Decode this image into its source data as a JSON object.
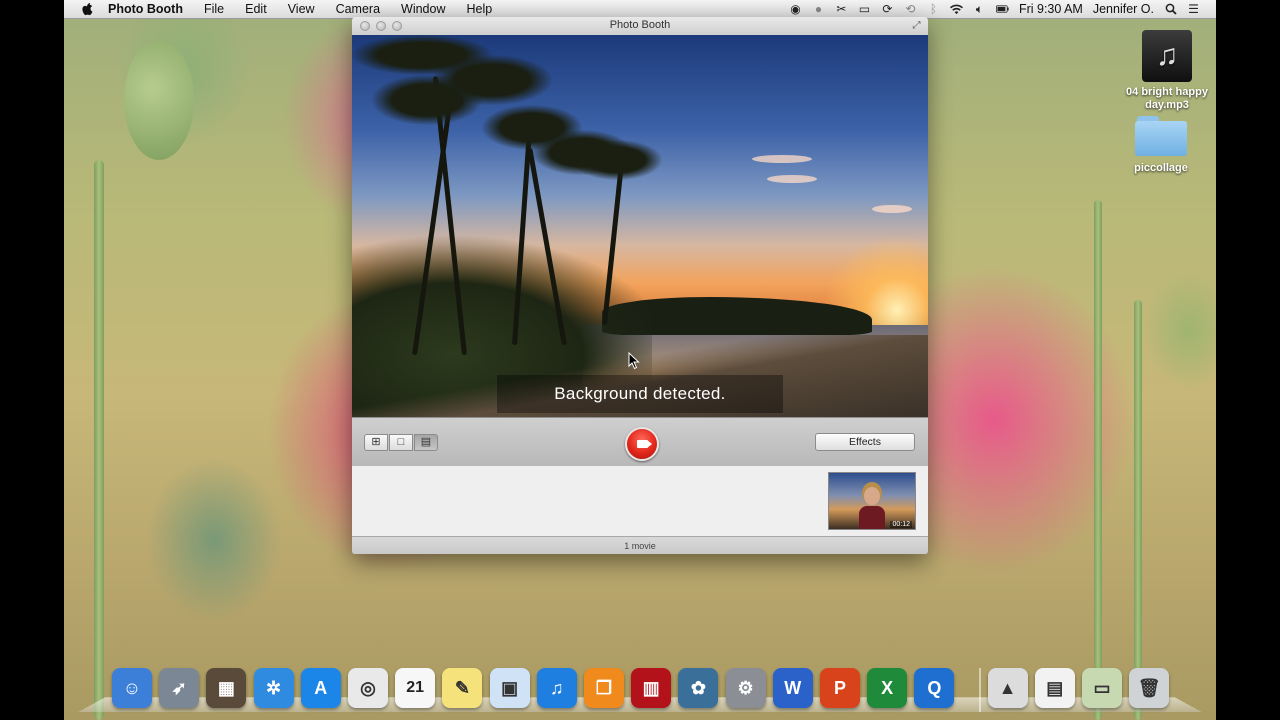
{
  "menubar": {
    "app_name": "Photo Booth",
    "menus": [
      "File",
      "Edit",
      "View",
      "Camera",
      "Window",
      "Help"
    ],
    "clock": "Fri 9:30 AM",
    "user": "Jennifer O."
  },
  "desktop_icons": [
    {
      "label": "04 bright happy day.mp3",
      "kind": "music-file"
    },
    {
      "label": "piccollage",
      "kind": "folder"
    }
  ],
  "window": {
    "title": "Photo Booth",
    "preview_message": "Background detected.",
    "effects_label": "Effects",
    "thumbnail_duration": "00:12",
    "status": "1 movie"
  },
  "dock": [
    {
      "name": "Finder",
      "icon": "finder-icon",
      "color": "#3b7fd8"
    },
    {
      "name": "Launchpad",
      "icon": "rocket-icon",
      "color": "#7c8796"
    },
    {
      "name": "Photo Booth",
      "icon": "photo-booth-icon",
      "color": "#5a4a3a"
    },
    {
      "name": "Safari",
      "icon": "compass-icon",
      "color": "#2f8be0"
    },
    {
      "name": "App Store",
      "icon": "app-store-icon",
      "color": "#1c86e8"
    },
    {
      "name": "Chrome",
      "icon": "chrome-icon",
      "color": "#e9e9e9"
    },
    {
      "name": "Calendar",
      "icon": "calendar-icon",
      "color": "#f7f7f7"
    },
    {
      "name": "Stickies",
      "icon": "notes-icon",
      "color": "#f5e27a"
    },
    {
      "name": "Preview",
      "icon": "preview-icon",
      "color": "#cfe2f6"
    },
    {
      "name": "iTunes",
      "icon": "music-note-icon",
      "color": "#1f7fe0"
    },
    {
      "name": "iBooks",
      "icon": "book-icon",
      "color": "#f08a1c"
    },
    {
      "name": "Photo Booth",
      "icon": "curtain-icon",
      "color": "#b3121a"
    },
    {
      "name": "iPhoto",
      "icon": "iphoto-icon",
      "color": "#3a6f9a"
    },
    {
      "name": "System Preferences",
      "icon": "gear-icon",
      "color": "#8b8f95"
    },
    {
      "name": "Word",
      "icon": "word-icon",
      "color": "#2a62c9",
      "glyph": "W"
    },
    {
      "name": "PowerPoint",
      "icon": "powerpoint-icon",
      "color": "#d9431b",
      "glyph": "P"
    },
    {
      "name": "Excel",
      "icon": "excel-icon",
      "color": "#1f8a3a",
      "glyph": "X"
    },
    {
      "name": "QuickTime",
      "icon": "quicktime-icon",
      "color": "#1f6fd1",
      "glyph": "Q"
    },
    {
      "name": "Applications",
      "icon": "applications-folder-icon",
      "color": "#dcdcdc"
    },
    {
      "name": "Documents",
      "icon": "document-icon",
      "color": "#f2f2f2"
    },
    {
      "name": "Downloads",
      "icon": "downloads-icon",
      "color": "#c7d9b0"
    },
    {
      "name": "Trash",
      "icon": "trash-icon",
      "color": "#cfd3d6"
    }
  ]
}
